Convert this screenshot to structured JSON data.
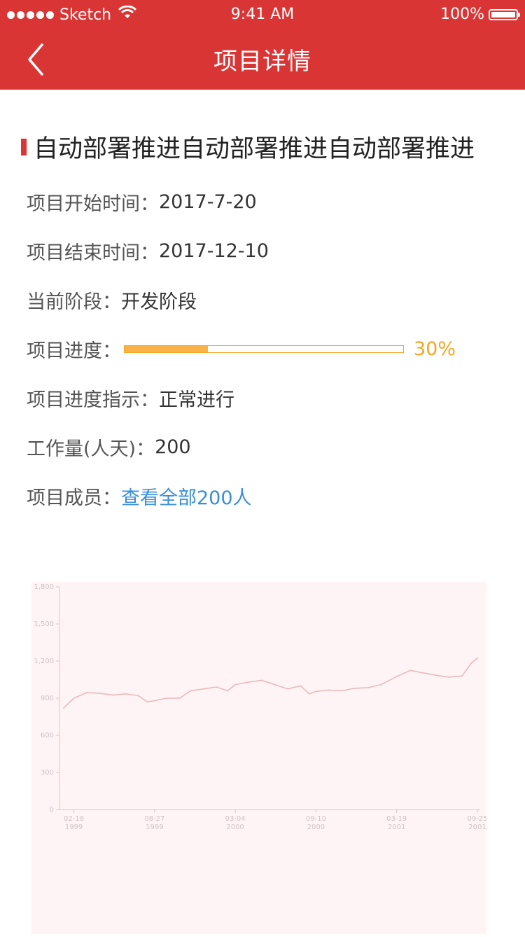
{
  "status_bar": {
    "carrier": "Sketch",
    "time": "9:41 AM",
    "battery": "100%"
  },
  "nav": {
    "title": "项目详情"
  },
  "project": {
    "title": "自动部署推进自动部署推进自动部署推进",
    "start_label": "项目开始时间：",
    "start_value": "2017-7-20",
    "end_label": "项目结束时间：",
    "end_value": "2017-12-10",
    "stage_label": "当前阶段：",
    "stage_value": "开发阶段",
    "progress_label": "项目进度：",
    "progress_value": 0.3,
    "progress_text": "30%",
    "indicator_label": "项目进度指示：",
    "indicator_value": "正常进行",
    "workload_label": "工作量(人天)：",
    "workload_value": "200",
    "members_label": "项目成员：",
    "members_link": "查看全部200人"
  },
  "colors": {
    "brand": "#d93535",
    "progress": "#f5a623",
    "link": "#3a8fd8",
    "series": "#e9b9bc"
  },
  "chart_data": {
    "type": "line",
    "ylim": [
      0,
      1800
    ],
    "yticks": [
      "0",
      "300",
      "600",
      "900",
      "1,200",
      "1,500",
      "1,800"
    ],
    "xticks": [
      {
        "day": "02-18",
        "year": "1999"
      },
      {
        "day": "08-27",
        "year": "1999"
      },
      {
        "day": "03-04",
        "year": "2000"
      },
      {
        "day": "09-10",
        "year": "2000"
      },
      {
        "day": "03-19",
        "year": "2001"
      },
      {
        "day": "09-25",
        "year": "2001"
      }
    ],
    "x": [
      "1999-01-25",
      "1999-02-18",
      "1999-03-20",
      "1999-04-20",
      "1999-05-20",
      "1999-06-20",
      "1999-07-20",
      "1999-08-10",
      "1999-08-27",
      "1999-09-25",
      "1999-10-25",
      "1999-11-20",
      "1999-12-20",
      "2000-01-20",
      "2000-02-15",
      "2000-03-04",
      "2000-04-05",
      "2000-05-05",
      "2000-06-05",
      "2000-07-05",
      "2000-08-05",
      "2000-08-25",
      "2000-09-10",
      "2000-10-10",
      "2000-11-10",
      "2000-12-10",
      "2001-01-10",
      "2001-02-10",
      "2001-03-19",
      "2001-04-20",
      "2001-05-20",
      "2001-06-20",
      "2001-07-20",
      "2001-08-20",
      "2001-09-10",
      "2001-09-25"
    ],
    "values": [
      820,
      900,
      945,
      940,
      925,
      935,
      920,
      870,
      880,
      900,
      900,
      960,
      975,
      990,
      960,
      1010,
      1030,
      1045,
      1010,
      975,
      1000,
      935,
      955,
      965,
      960,
      980,
      985,
      1010,
      1075,
      1125,
      1105,
      1085,
      1070,
      1080,
      1180,
      1225
    ]
  }
}
